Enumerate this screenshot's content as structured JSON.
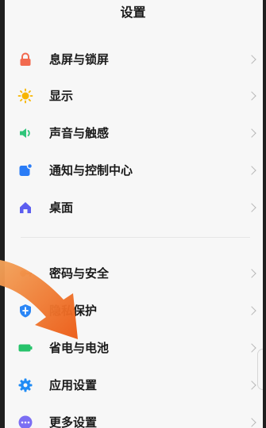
{
  "header": {
    "title": "设置"
  },
  "items": [
    {
      "label": "息屏与锁屏",
      "icon": "lock-icon",
      "color": "#f26a4f"
    },
    {
      "label": "显示",
      "icon": "sun-icon",
      "color": "#f7b500"
    },
    {
      "label": "声音与触感",
      "icon": "speaker-icon",
      "color": "#2fc57a"
    },
    {
      "label": "通知与控制中心",
      "icon": "notification-icon",
      "color": "#2a7cf6"
    },
    {
      "label": "桌面",
      "icon": "home-icon",
      "color": "#5c5ef0"
    },
    {
      "label": "密码与安全",
      "icon": "key-icon",
      "color": "#f07a2a"
    },
    {
      "label": "隐私保护",
      "icon": "shield-icon",
      "color": "#2a86f6"
    },
    {
      "label": "省电与电池",
      "icon": "battery-icon",
      "color": "#27c36b"
    },
    {
      "label": "应用设置",
      "icon": "gear-icon",
      "color": "#1f8bf5"
    },
    {
      "label": "更多设置",
      "icon": "more-icon",
      "color": "#7b6ef3"
    }
  ],
  "colors": {
    "background": "#f7f7f7",
    "arrow": "#f06a1e"
  }
}
